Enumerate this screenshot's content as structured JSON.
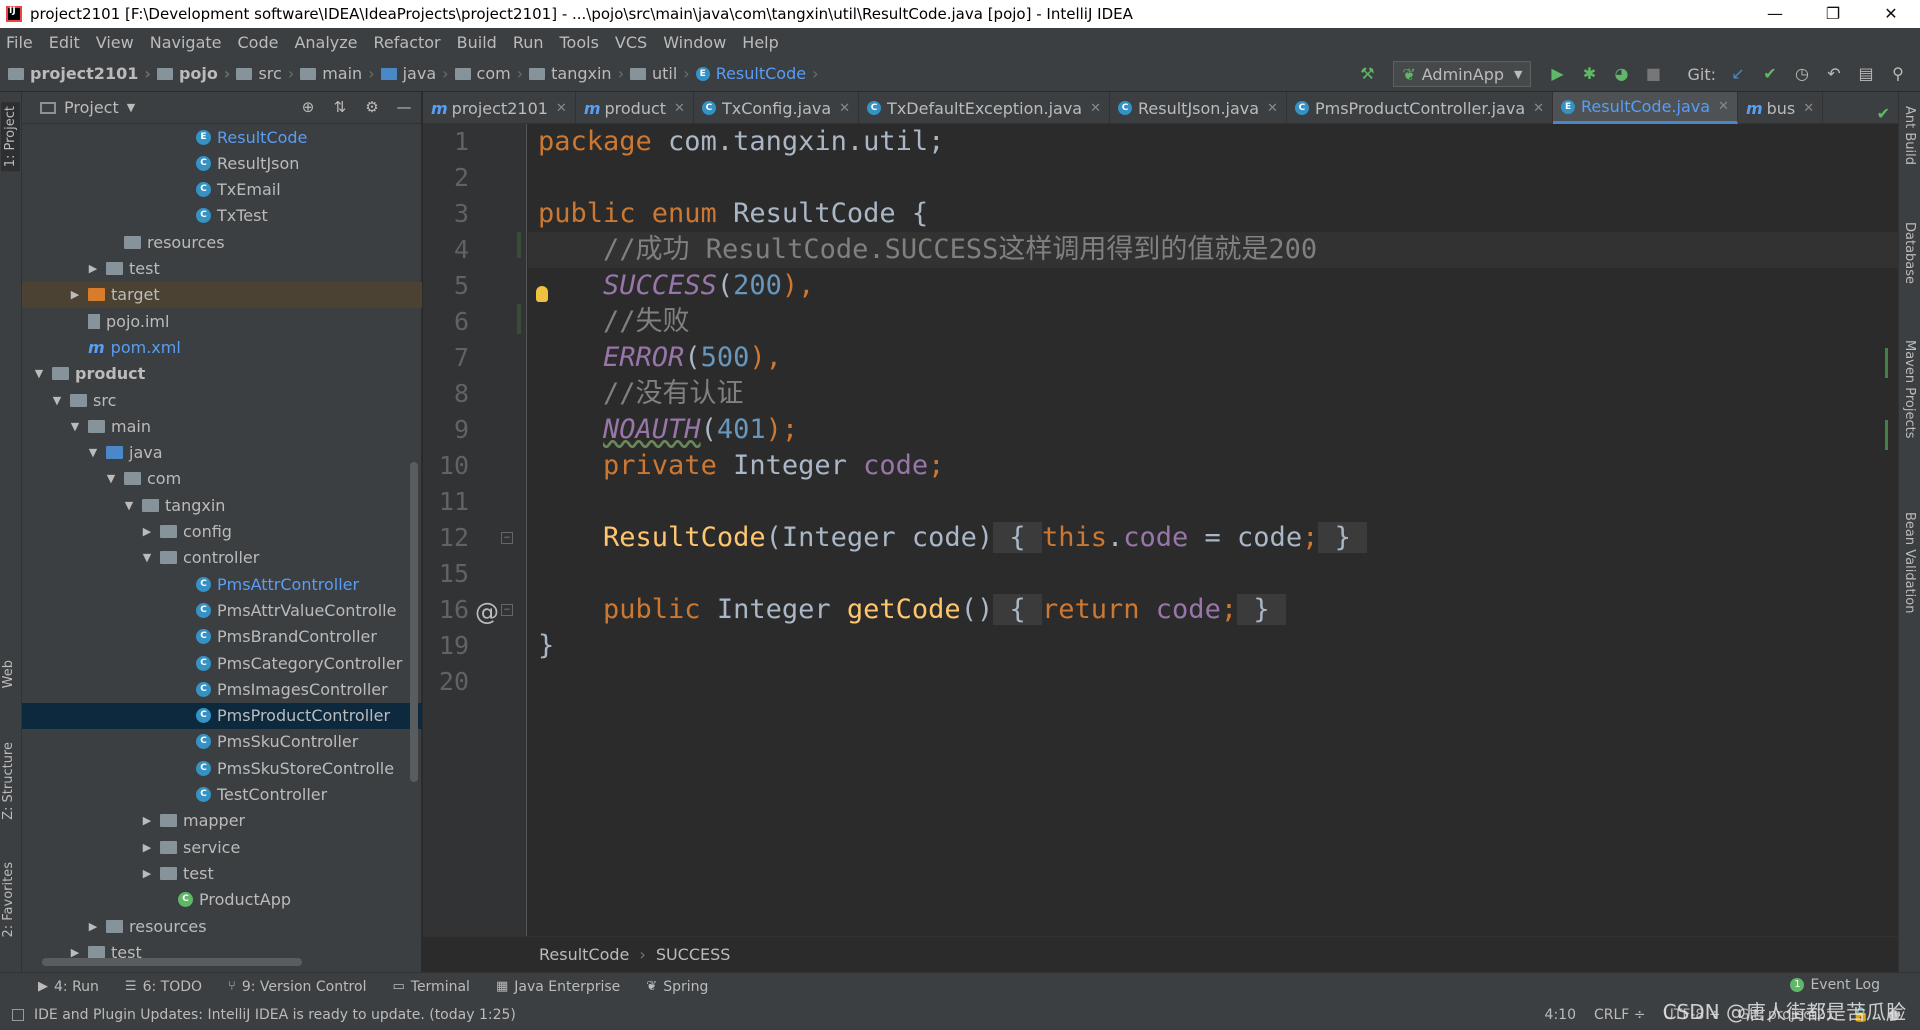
{
  "window": {
    "title": "project2101 [F:\\Development software\\IDEA\\IdeaProjects\\project2101] - ...\\pojo\\src\\main\\java\\com\\tangxin\\util\\ResultCode.java [pojo] - IntelliJ IDEA",
    "minimize": "—",
    "restore": "❐",
    "close": "✕"
  },
  "menu": [
    "File",
    "Edit",
    "View",
    "Navigate",
    "Code",
    "Analyze",
    "Refactor",
    "Build",
    "Run",
    "Tools",
    "VCS",
    "Window",
    "Help"
  ],
  "breadcrumbs": [
    "project2101",
    "pojo",
    "src",
    "main",
    "java",
    "com",
    "tangxin",
    "util",
    "ResultCode"
  ],
  "toolbar": {
    "run_config": "AdminApp",
    "git_label": "Git:"
  },
  "project_panel": {
    "title": "Project",
    "tree": [
      {
        "label": "ResultCode",
        "kind": "enum",
        "level": 9,
        "color": "blue"
      },
      {
        "label": "ResultJson",
        "kind": "class",
        "level": 9
      },
      {
        "label": "TxEmail",
        "kind": "class",
        "level": 9
      },
      {
        "label": "TxTest",
        "kind": "class",
        "level": 9
      },
      {
        "label": "resources",
        "kind": "folder",
        "level": 5
      },
      {
        "label": "test",
        "kind": "folder",
        "level": 4,
        "arrow": "▶"
      },
      {
        "label": "target",
        "kind": "folder-orange",
        "level": 3,
        "arrow": "▶"
      },
      {
        "label": "pojo.iml",
        "kind": "file",
        "level": 3
      },
      {
        "label": "pom.xml",
        "kind": "maven",
        "level": 3,
        "color": "blue"
      },
      {
        "label": "product",
        "kind": "folder",
        "level": 1,
        "arrow": "▼",
        "bold": true
      },
      {
        "label": "src",
        "kind": "folder",
        "level": 2,
        "arrow": "▼"
      },
      {
        "label": "main",
        "kind": "folder",
        "level": 3,
        "arrow": "▼"
      },
      {
        "label": "java",
        "kind": "folder-src",
        "level": 4,
        "arrow": "▼"
      },
      {
        "label": "com",
        "kind": "folder",
        "level": 5,
        "arrow": "▼"
      },
      {
        "label": "tangxin",
        "kind": "folder",
        "level": 6,
        "arrow": "▼"
      },
      {
        "label": "config",
        "kind": "folder",
        "level": 7,
        "arrow": "▶"
      },
      {
        "label": "controller",
        "kind": "folder",
        "level": 7,
        "arrow": "▼"
      },
      {
        "label": "PmsAttrController",
        "kind": "class",
        "level": 9,
        "color": "blue"
      },
      {
        "label": "PmsAttrValueControlle",
        "kind": "class",
        "level": 9
      },
      {
        "label": "PmsBrandController",
        "kind": "class",
        "level": 9
      },
      {
        "label": "PmsCategoryController",
        "kind": "class",
        "level": 9
      },
      {
        "label": "PmsImagesController",
        "kind": "class",
        "level": 9
      },
      {
        "label": "PmsProductController",
        "kind": "class",
        "level": 9,
        "selected": true
      },
      {
        "label": "PmsSkuController",
        "kind": "class",
        "level": 9
      },
      {
        "label": "PmsSkuStoreControlle",
        "kind": "class",
        "level": 9
      },
      {
        "label": "TestController",
        "kind": "class",
        "level": 9
      },
      {
        "label": "mapper",
        "kind": "folder",
        "level": 7,
        "arrow": "▶"
      },
      {
        "label": "service",
        "kind": "folder",
        "level": 7,
        "arrow": "▶"
      },
      {
        "label": "test",
        "kind": "folder",
        "level": 7,
        "arrow": "▶"
      },
      {
        "label": "ProductApp",
        "kind": "app",
        "level": 8
      },
      {
        "label": "resources",
        "kind": "folder",
        "level": 4,
        "arrow": "▶"
      },
      {
        "label": "test",
        "kind": "folder",
        "level": 3,
        "arrow": "▶"
      }
    ]
  },
  "tabs": [
    {
      "label": "project2101",
      "icon": "m"
    },
    {
      "label": "product",
      "icon": "m"
    },
    {
      "label": "TxConfig.java",
      "icon": "c"
    },
    {
      "label": "TxDefaultException.java",
      "icon": "c"
    },
    {
      "label": "ResultJson.java",
      "icon": "c"
    },
    {
      "label": "PmsProductController.java",
      "icon": "c"
    },
    {
      "label": "ResultCode.java",
      "icon": "e",
      "active": true
    },
    {
      "label": "bus",
      "icon": "m"
    }
  ],
  "line_numbers": [
    "1",
    "2",
    "3",
    "4",
    "5",
    "6",
    "7",
    "8",
    "9",
    "10",
    "11",
    "12",
    "15",
    "16",
    "19",
    "20"
  ],
  "code": {
    "l1_kw": "package",
    "l1_rest": " com.tangxin.util;",
    "l3_kw": "public enum",
    "l3_rest": " ResultCode {",
    "l4": "    //成功 ResultCode.SUCCESS这样调用得到的值就是200",
    "l5_name": "SUCCESS",
    "l5_num": "200",
    "l6": "    //失败",
    "l7_name": "ERROR",
    "l7_num": "500",
    "l8": "    //没有认证",
    "l9_name": "NOAUTH",
    "l9_num": "401",
    "l10_kw": "private",
    "l10_type": " Integer ",
    "l10_field": "code",
    "l12_fn": "ResultCode",
    "l12_params": "(Integer code)",
    "l12_this": "this",
    "l12_field": "code",
    "l12_rest": " = code",
    "l16_kw": "public",
    "l16_type": " Integer ",
    "l16_fn": "getCode",
    "l16_ret": "return",
    "l16_field": "code",
    "l19": "}"
  },
  "gutter_annotation": "@",
  "editor_breadcrumb": [
    "ResultCode",
    "SUCCESS"
  ],
  "left_tool_tabs": [
    "1: Project",
    "Web",
    "Z: Structure",
    "2: Favorites"
  ],
  "right_tool_tabs": [
    "Ant Build",
    "Database",
    "Maven Projects",
    "Bean Validation"
  ],
  "bottom_tools": [
    {
      "icon": "▶",
      "label": "4: Run"
    },
    {
      "icon": "☰",
      "label": "6: TODO"
    },
    {
      "icon": "⑂",
      "label": "9: Version Control"
    },
    {
      "icon": "▭",
      "label": "Terminal"
    },
    {
      "icon": "▦",
      "label": "Java Enterprise"
    },
    {
      "icon": "❦",
      "label": "Spring"
    }
  ],
  "event_log": {
    "count": "1",
    "label": "Event Log"
  },
  "status": {
    "message": "IDE and Plugin Updates: IntelliJ IDEA is ready to update. (today 1:25)",
    "position": "4:10",
    "line_sep": "CRLF ÷",
    "encoding": "UTF-8 ÷",
    "git": "Git: project21"
  },
  "watermark": "CSDN @唐人街都是苦瓜脸"
}
